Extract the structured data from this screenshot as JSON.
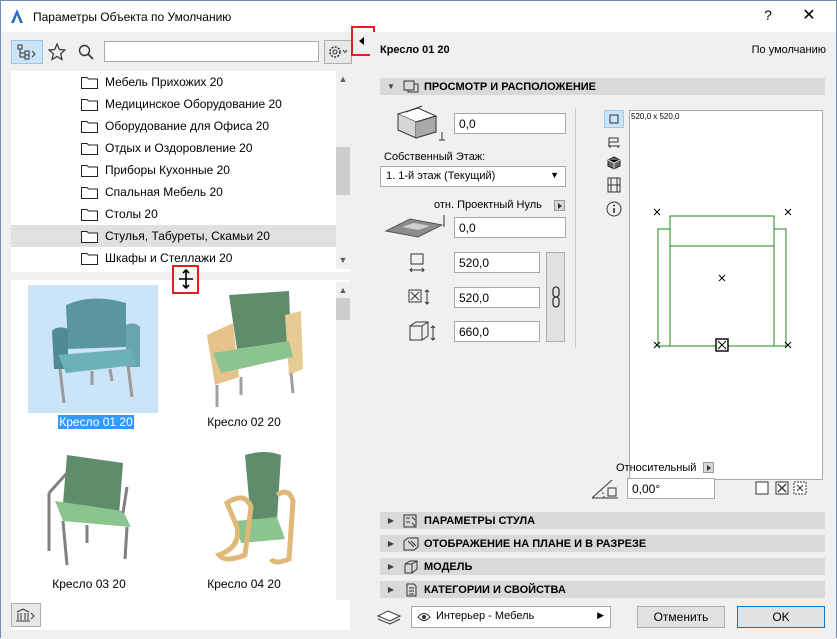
{
  "window": {
    "title": "Параметры Объекта по Умолчанию",
    "help_label": "?",
    "close_label": "✕"
  },
  "toolbar": {
    "search_value": ""
  },
  "tree": {
    "items": [
      {
        "label": "Мебель Прихожих 20"
      },
      {
        "label": "Медицинское Оборудование 20"
      },
      {
        "label": "Оборудование для Офиса 20"
      },
      {
        "label": "Отдых и Оздоровление 20"
      },
      {
        "label": "Приборы Кухонные 20"
      },
      {
        "label": "Спальная Мебель 20"
      },
      {
        "label": "Столы 20"
      },
      {
        "label": "Стулья, Табуреты, Скамьи 20",
        "selected": true
      },
      {
        "label": "Шкафы и Стеллажи 20"
      }
    ]
  },
  "thumbnails": [
    {
      "caption": "Кресло 01 20",
      "selected": true
    },
    {
      "caption": "Кресло 02 20"
    },
    {
      "caption": "Кресло 03 20"
    },
    {
      "caption": "Кресло 04 20"
    }
  ],
  "header": {
    "object_name": "Кресло 01 20",
    "default_label": "По умолчанию"
  },
  "sections": {
    "preview": "ПРОСМОТР И РАСПОЛОЖЕНИЕ",
    "chair_params": "ПАРАМЕТРЫ СТУЛА",
    "plan_display": "ОТОБРАЖЕНИЕ НА ПЛАНЕ И В РАЗРЕЗЕ",
    "model": "МОДЕЛЬ",
    "categories": "КАТЕГОРИИ И СВОЙСТВА"
  },
  "placement": {
    "top_offset": "0,0",
    "home_story_label": "Собственный Этаж:",
    "home_story_value": "1. 1-й этаж (Текущий)",
    "ref_label": "отн. Проектный Нуль",
    "elevation": "0,0",
    "width": "520,0",
    "depth": "520,0",
    "height": "660,0",
    "size_readout": "520,0 x 520,0",
    "relative_label": "Относительный",
    "angle": "0,00°"
  },
  "footer": {
    "layer": "Интерьер - Мебель",
    "cancel_label": "Отменить",
    "ok_label": "OK"
  }
}
